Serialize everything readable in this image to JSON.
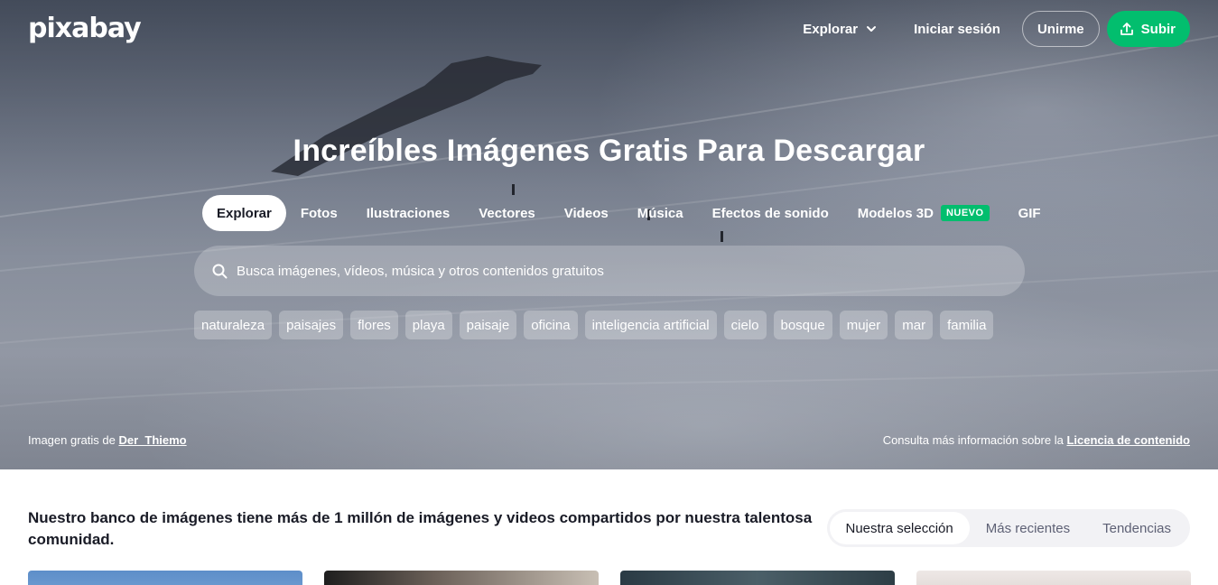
{
  "brand": {
    "logo_text": "pixabay"
  },
  "topnav": {
    "explore": "Explorar",
    "signin": "Iniciar sesión",
    "join": "Unirme",
    "upload": "Subir"
  },
  "hero": {
    "title": "Increíbles Imágenes Gratis Para Descargar",
    "tabs": [
      {
        "label": "Explorar",
        "active": true
      },
      {
        "label": "Fotos"
      },
      {
        "label": "Ilustraciones"
      },
      {
        "label": "Vectores"
      },
      {
        "label": "Videos"
      },
      {
        "label": "Música"
      },
      {
        "label": "Efectos de sonido"
      },
      {
        "label": "Modelos 3D",
        "badge": "NUEVO"
      },
      {
        "label": "GIF"
      }
    ],
    "search_placeholder": "Busca imágenes, vídeos, música y otros contenidos gratuitos",
    "chips": [
      "naturaleza",
      "paisajes",
      "flores",
      "playa",
      "paisaje",
      "oficina",
      "inteligencia artificial",
      "cielo",
      "bosque",
      "mujer",
      "mar",
      "familia"
    ],
    "credit_prefix": "Imagen gratis de",
    "credit_author": "Der_Thiemo",
    "license_prefix": "Consulta más información sobre la",
    "license_link": "Licencia de contenido"
  },
  "intro_text": "Nuestro banco de imágenes tiene más de 1 millón de imágenes y videos compartidos por nuestra talentosa comunidad.",
  "sort_tabs": [
    {
      "label": "Nuestra selección",
      "active": true
    },
    {
      "label": "Más recientes"
    },
    {
      "label": "Tendencias"
    }
  ],
  "colors": {
    "accent": "#02be6e",
    "text": "#191b26"
  }
}
